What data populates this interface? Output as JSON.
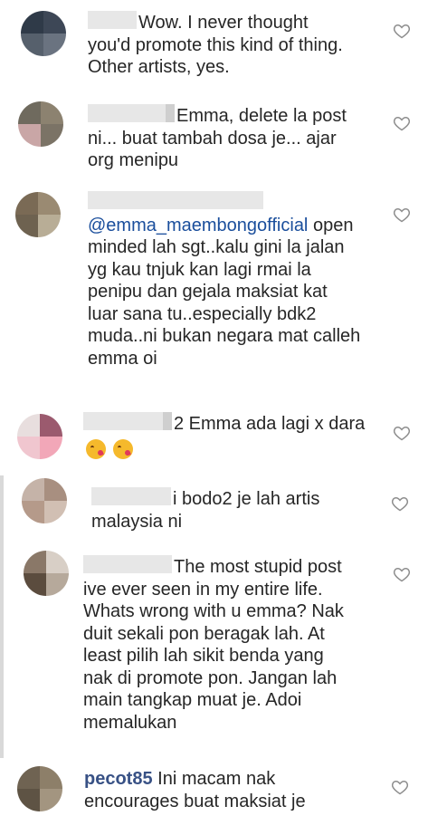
{
  "comments": [
    {
      "lines": [
        "Wow. I never thought",
        "you'd promote this kind of thing.",
        "Other artists, yes."
      ],
      "avatar_colors": [
        "#2f3a48",
        "#3d4756",
        "#56606c",
        "#6a7380"
      ]
    },
    {
      "lines": [
        "Emma, delete la post",
        "ni... buat tambah dosa je... ajar",
        "org menipu"
      ],
      "avatar_colors": [
        "#6f6a5e",
        "#8c8270",
        "#c9a6a6",
        "#7b7366"
      ]
    },
    {
      "mention": "@emma_maembongofficial",
      "lines": [
        "open",
        "minded lah sgt..kalu gini la jalan",
        "yg kau tnjuk kan lagi rmai la",
        "penipu dan gejala maksiat kat",
        "luar sana tu..especially bdk2",
        "muda..ni bukan negara mat calleh",
        "emma oi"
      ],
      "avatar_colors": [
        "#7a6a55",
        "#9a8a72",
        "#6e6250",
        "#b8ad96"
      ]
    },
    {
      "lines": [
        "2 Emma ada lagi x dara"
      ],
      "emoji": [
        "kissing-face-wink",
        "kissing-face-wink"
      ],
      "avatar_colors": [
        "#e8dede",
        "#9b5a6e",
        "#f0c6cf",
        "#f2a7b8"
      ]
    },
    {
      "lines": [
        "i bodo2 je lah artis",
        "malaysia ni"
      ],
      "avatar_colors": [
        "#c5b3a8",
        "#a88f80",
        "#b59a8a",
        "#d1bfb3"
      ]
    },
    {
      "lines": [
        "The most stupid post",
        "ive ever seen in my entire life.",
        "Whats wrong with u emma? Nak",
        "duit sekali pon beragak lah. At",
        "least pilih lah sikit benda yang",
        "nak di promote pon. Jangan lah",
        "main tangkap muat je. Adoi",
        "memalukan"
      ],
      "avatar_colors": [
        "#8a7868",
        "#d8cfc6",
        "#5b4c3e",
        "#b6a99b"
      ]
    },
    {
      "username": "pecot85",
      "lines": [
        "Ini macam nak",
        "encourages buat maksiat je"
      ],
      "avatar_colors": [
        "#6f6352",
        "#8d7f69",
        "#5e5344",
        "#a39580"
      ]
    }
  ]
}
